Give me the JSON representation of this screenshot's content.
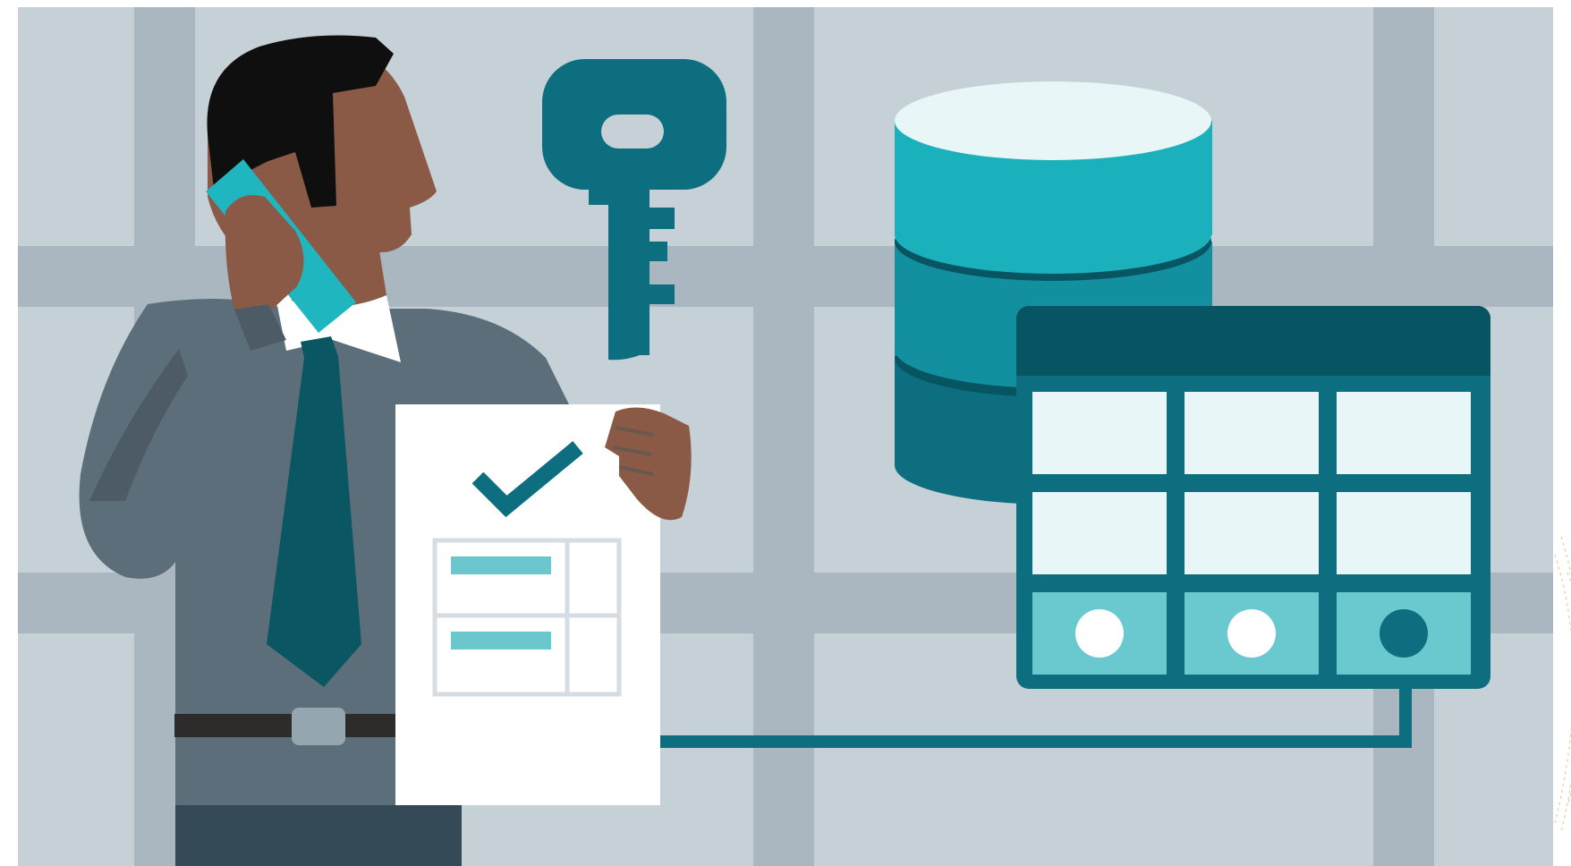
{
  "colors": {
    "page_background": "#ffffff",
    "wall_panel": "#c5d0d7",
    "wall_grid": "#abb7c0",
    "teal_dark": "#0c6e7e",
    "teal_deeper": "#075563",
    "teal_mid": "#13909f",
    "teal_light": "#1bb1bc",
    "teal_pale": "#6ac8cf",
    "cell_pale": "#e8f6f8",
    "skin": "#8b5a47",
    "hair": "#0f0f10",
    "suit": "#5d6e7b",
    "suit_shadow": "#4c5b66",
    "trousers": "#344a57",
    "tie": "#0a5662",
    "shirt": "#ffffff",
    "belt": "#2e2b2b",
    "buckle": "#96a6b1",
    "paper": "#ffffff",
    "paper_line": "#6ac7cd",
    "paper_grid": "#d5dde2",
    "phone": "#1fb6c0",
    "accent_stripes": "#f2c6a0"
  },
  "icons": [
    "person-on-phone-icon",
    "key-icon",
    "checkmark-icon",
    "database-cylinder-icon",
    "data-table-icon",
    "connector-line-icon"
  ],
  "table": {
    "rows": 3,
    "columns": 3,
    "filled_markers": [
      1,
      1,
      0
    ]
  }
}
